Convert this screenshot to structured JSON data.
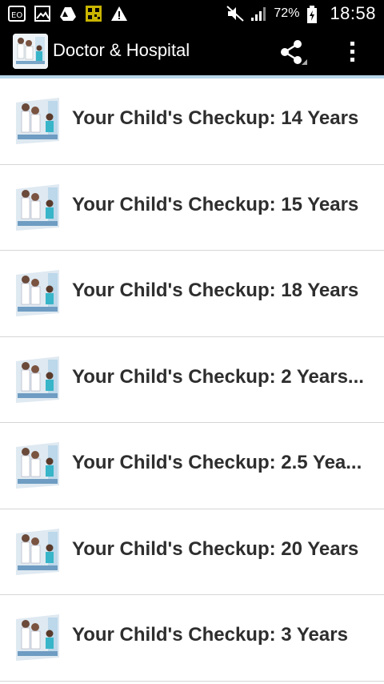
{
  "status_bar": {
    "left_icons": [
      "eo-icon",
      "image-icon",
      "drive-icon",
      "qr-icon",
      "warning-icon"
    ],
    "battery_percent": "72%",
    "time": "18:58"
  },
  "action_bar": {
    "title": "Doctor & Hospital"
  },
  "list": {
    "items": [
      {
        "label": "Your Child's Checkup: 14 Years"
      },
      {
        "label": "Your Child's Checkup: 15 Years"
      },
      {
        "label": "Your Child's Checkup: 18 Years"
      },
      {
        "label": "Your Child's Checkup: 2 Years..."
      },
      {
        "label": "Your Child's Checkup: 2.5 Yea..."
      },
      {
        "label": "Your Child's Checkup: 20 Years"
      },
      {
        "label": "Your Child's Checkup: 3 Years"
      }
    ]
  }
}
